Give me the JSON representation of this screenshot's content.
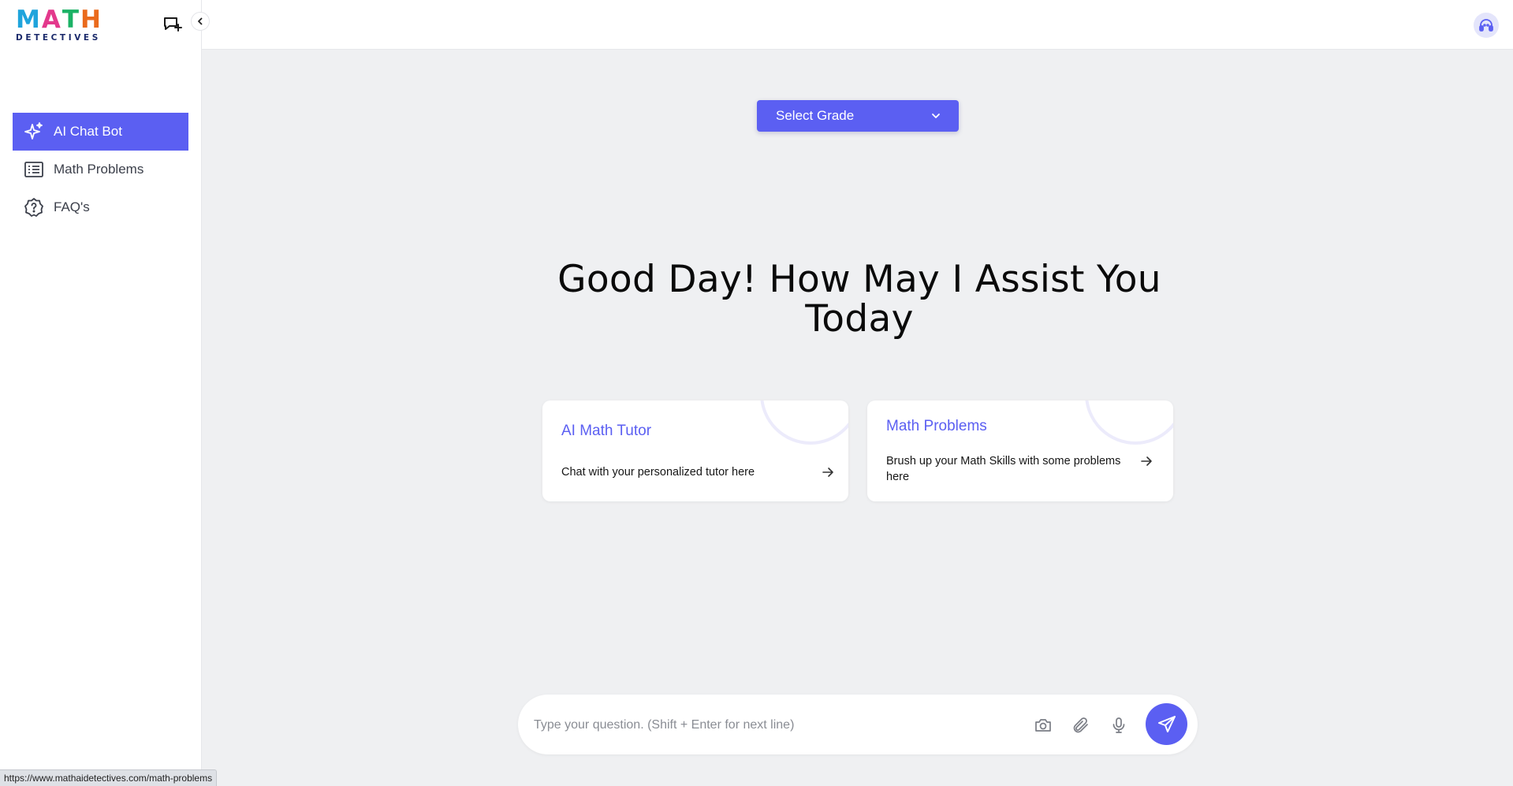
{
  "brand": {
    "logo_letters": [
      "M",
      "A",
      "T",
      "H"
    ],
    "logo_letter_colors": [
      "#1fa4dc",
      "#e3398c",
      "#1bb265",
      "#ea6a1c"
    ],
    "logo_sub": "DETECTIVES"
  },
  "sidebar": {
    "items": [
      {
        "label": "AI Chat Bot",
        "icon": "sparkle-icon",
        "active": true
      },
      {
        "label": "Math Problems",
        "icon": "list-icon",
        "active": false
      },
      {
        "label": "FAQ's",
        "icon": "question-badge-icon",
        "active": false
      }
    ]
  },
  "header": {
    "new_chat_icon": "new-chat-icon",
    "collapse_icon": "chevron-left-icon",
    "avatar_icon": "support-headset-icon"
  },
  "main": {
    "grade_select": {
      "selected": "Select Grade"
    },
    "headline": "Good Day! How May I Assist You Today",
    "cards": [
      {
        "title": "AI Math Tutor",
        "description": "Chat with your personalized tutor here"
      },
      {
        "title": "Math Problems",
        "description": "Brush up your Math Skills with some problems here"
      }
    ]
  },
  "chat": {
    "placeholder": "Type your question. (Shift + Enter for next line)",
    "value": ""
  },
  "status_bar": {
    "url": "https://www.mathaidetectives.com/math-problems"
  },
  "colors": {
    "accent": "#5b5ff2",
    "background": "#eff0f2"
  }
}
